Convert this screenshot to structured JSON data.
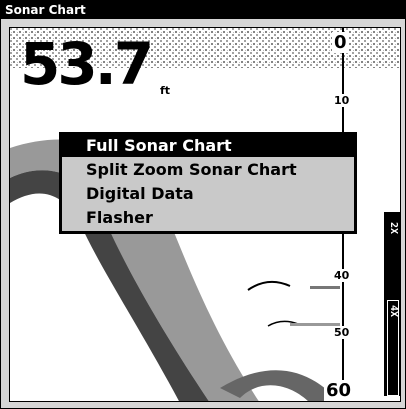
{
  "window": {
    "title": "Sonar Chart"
  },
  "readout": {
    "depth": "53.7",
    "unit": "ft"
  },
  "scale": {
    "labels": [
      "0",
      "10",
      "40",
      "50",
      "60"
    ]
  },
  "zoom": {
    "levels": [
      "2X",
      "4X"
    ]
  },
  "menu": {
    "items": [
      {
        "label": "Full Sonar Chart",
        "selected": true
      },
      {
        "label": "Split Zoom Sonar Chart",
        "selected": false
      },
      {
        "label": "Digital Data",
        "selected": false
      },
      {
        "label": "Flasher",
        "selected": false
      }
    ]
  }
}
